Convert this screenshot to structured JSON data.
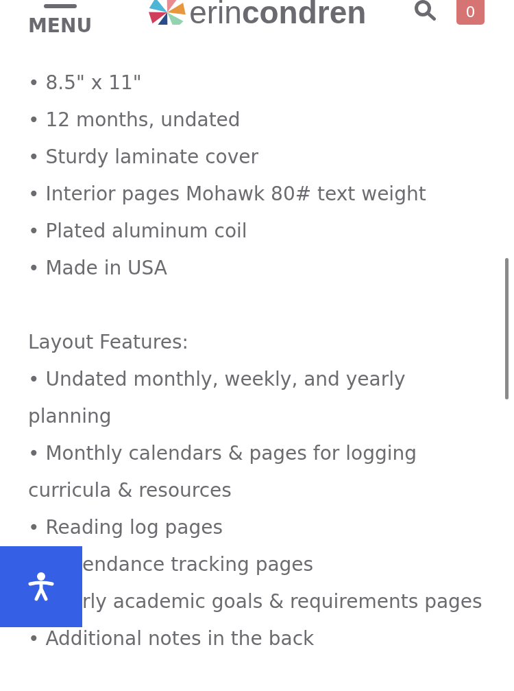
{
  "header": {
    "menu_label": "MENU",
    "logo_text": "erin**condren**",
    "cart_count": "0"
  },
  "specs": [
    "• 8.5\" x 11\"",
    "• 12 months, undated",
    "• Sturdy laminate cover",
    "• Interior pages Mohawk 80# text weight",
    "• Plated aluminum coil",
    "• Made in USA"
  ],
  "layout_features": {
    "heading": "Layout Features:",
    "items": [
      {
        "kind": "text",
        "text": "• Undated monthly, weekly, and yearly planning"
      },
      {
        "kind": "text",
        "text": "• Monthly calendars & pages for logging curricula & resources"
      },
      {
        "kind": "text",
        "text": "• Reading log pages"
      },
      {
        "kind": "accessibility_button"
      },
      {
        "kind": "text",
        "text": "endance tracking pages"
      },
      {
        "kind": "text",
        "text": "rly academic goals & requirements pages"
      },
      {
        "kind": "text",
        "text": "• Additional notes in the back"
      }
    ]
  }
}
